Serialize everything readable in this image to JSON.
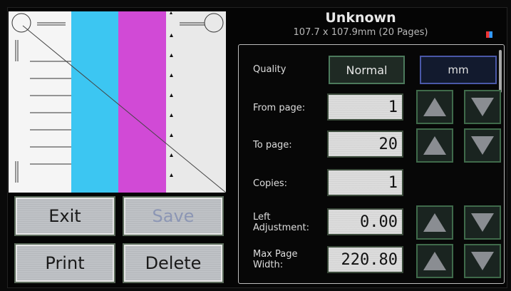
{
  "header": {
    "title": "Unknown",
    "subtitle": "107.7 x 107.9mm (20 Pages)"
  },
  "preview": {
    "stripe_colors": [
      "#ffffff",
      "#3cc6f2",
      "#d14ad6",
      "#ffffff"
    ]
  },
  "buttons": {
    "exit": "Exit",
    "save": "Save",
    "print": "Print",
    "delete": "Delete"
  },
  "settings": {
    "quality_label": "Quality",
    "quality_value": "Normal",
    "unit_value": "mm",
    "from_page_label": "From page:",
    "from_page_value": "1",
    "to_page_label": "To page:",
    "to_page_value": "20",
    "copies_label": "Copies:",
    "copies_value": "1",
    "left_adj_label_1": "Left",
    "left_adj_label_2": "Adjustment:",
    "left_adj_value": "0.00",
    "max_width_label_1": "Max Page",
    "max_width_label_2": "Width:",
    "max_width_value": "220.80"
  },
  "icons": {
    "up": "arrow-up-icon",
    "down": "arrow-down-icon"
  },
  "colors": {
    "accent_green": "#4c7a5c",
    "accent_blue": "#4a58a8",
    "button_gray": "#bfc2c6"
  }
}
